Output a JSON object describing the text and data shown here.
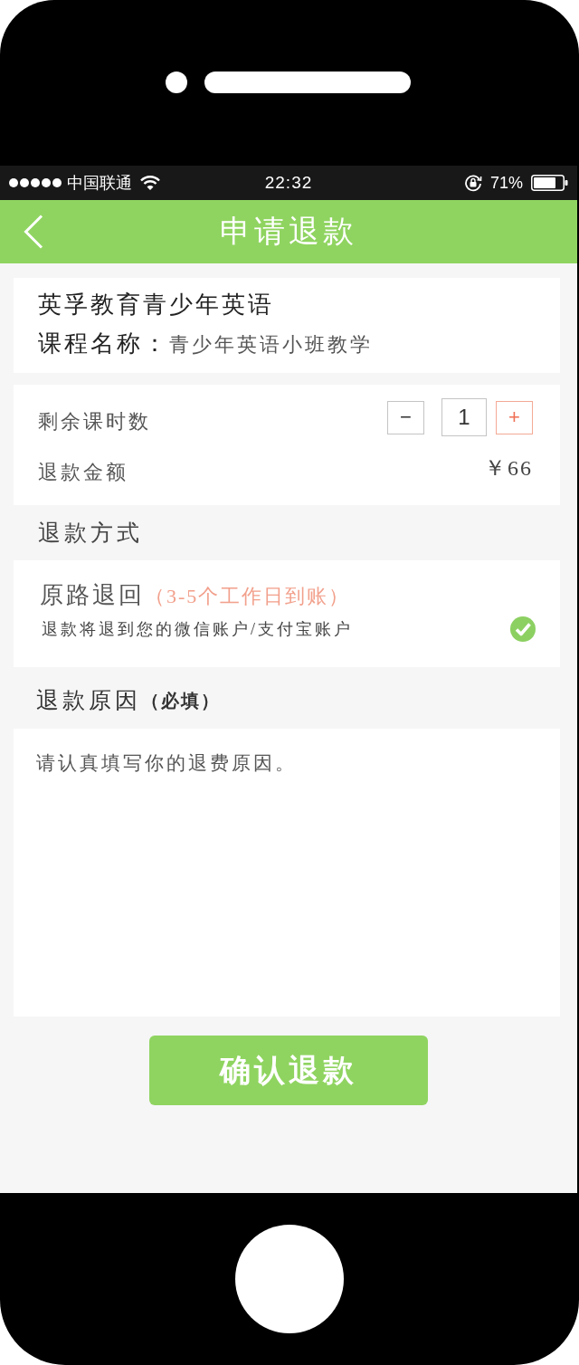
{
  "status_bar": {
    "carrier": "中国联通",
    "time": "22:32",
    "battery": "71%"
  },
  "nav_bar": {
    "title": "申请退款"
  },
  "course": {
    "school": "英孚教育青少年英语",
    "name_label": "课程名称：",
    "name_value": "青少年英语小班教学"
  },
  "lessons": {
    "label": "剩余课时数",
    "decrement": "−",
    "quantity": "1",
    "increment": "+"
  },
  "amount": {
    "label": "退款金额",
    "value": "￥66"
  },
  "refund_method": {
    "heading": "退款方式",
    "options": [
      {
        "title": "原路退回",
        "note": "（3-5个工作日到账）",
        "description": "退款将退到您的微信账户/支付宝账户",
        "selected": true
      }
    ]
  },
  "reason": {
    "heading": "退款原因",
    "note": "（必填）",
    "placeholder": "请认真填写你的退费原因。"
  },
  "submit_button": "确认退款"
}
